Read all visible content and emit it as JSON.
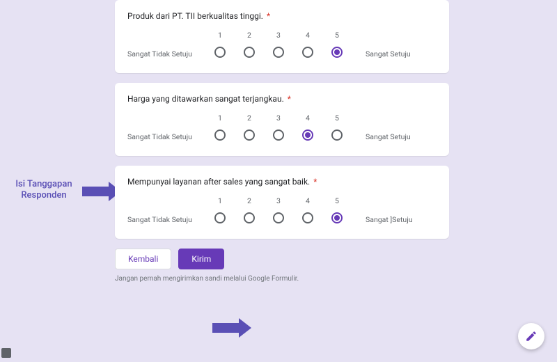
{
  "accent": "#673ab7",
  "annotation": {
    "label_line1": "Isi Tanggapan",
    "label_line2": "Responden"
  },
  "questions": [
    {
      "title": "Produk dari PT. TII berkualitas tinggi.",
      "required": "*",
      "left_label": "Sangat Tidak Setuju",
      "right_label": "Sangat Setuju",
      "options": [
        "1",
        "2",
        "3",
        "4",
        "5"
      ],
      "selected": 5
    },
    {
      "title": "Harga yang ditawarkan sangat terjangkau.",
      "required": "*",
      "left_label": "Sangat Tidak Setuju",
      "right_label": "Sangat Setuju",
      "options": [
        "1",
        "2",
        "3",
        "4",
        "5"
      ],
      "selected": 4
    },
    {
      "title": "Mempunyai layanan after sales yang sangat baik.",
      "required": "*",
      "left_label": "Sangat Tidak Setuju",
      "right_label": "Sangat ]Setuju",
      "options": [
        "1",
        "2",
        "3",
        "4",
        "5"
      ],
      "selected": 5
    }
  ],
  "buttons": {
    "back": "Kembali",
    "submit": "Kirim"
  },
  "disclaimer": "Jangan pernah mengirimkan sandi melalui Google Formulir."
}
